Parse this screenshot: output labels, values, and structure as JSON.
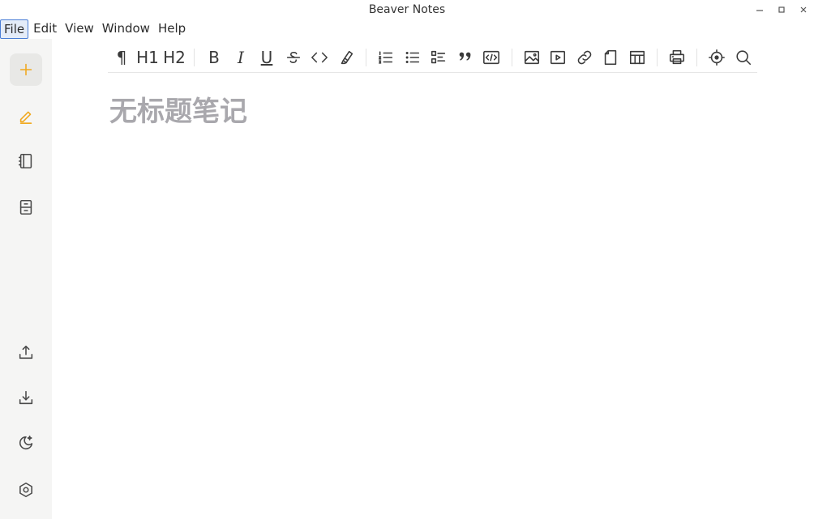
{
  "window": {
    "title": "Beaver Notes"
  },
  "menu": {
    "items": [
      "File",
      "Edit",
      "View",
      "Window",
      "Help"
    ]
  },
  "editor": {
    "title_placeholder": "无标题笔记"
  },
  "toolbar": {
    "paragraph": "¶",
    "h1": "H1",
    "h2": "H2",
    "bold": "B",
    "italic": "I",
    "underline": "U"
  },
  "colors": {
    "accent": "#f0a81e",
    "sidebar_bg": "#f5f5f4",
    "placeholder": "#a9a8ad"
  }
}
